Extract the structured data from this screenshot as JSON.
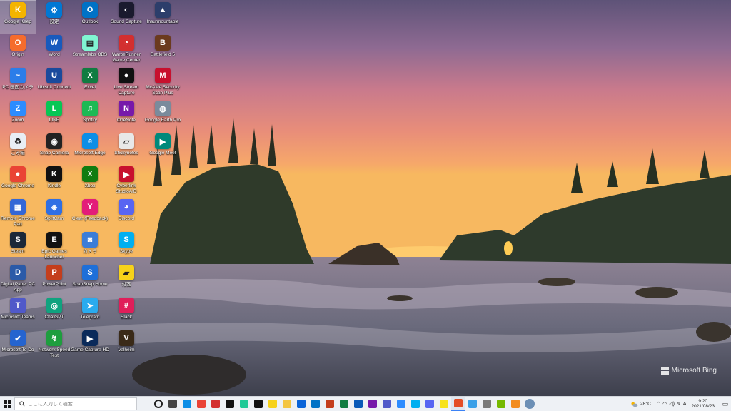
{
  "desktop_icons": [
    {
      "label": "Google Keep",
      "color": "#f4b400",
      "glyph": "K",
      "selected": true
    },
    {
      "label": "Origin",
      "color": "#f56c2d",
      "glyph": "O"
    },
    {
      "label": "PC 画面カメラ",
      "color": "#2b7de9",
      "glyph": "~"
    },
    {
      "label": "Zoom",
      "color": "#2d8cff",
      "glyph": "Z"
    },
    {
      "label": "ごみ箱",
      "color": "#e8eef5",
      "glyph": "♻"
    },
    {
      "label": "Google Chrome",
      "color": "#ea4335",
      "glyph": "●"
    },
    {
      "label": "Remote Chrome Pad",
      "color": "#3367d6",
      "glyph": "▦"
    },
    {
      "label": "Steam",
      "color": "#1b2838",
      "glyph": "S"
    },
    {
      "label": "Digital Paper PC App",
      "color": "#2b5aa8",
      "glyph": "D"
    },
    {
      "label": "Microsoft Teams",
      "color": "#5059c9",
      "glyph": "T"
    },
    {
      "label": "Microsoft To Do",
      "color": "#2564cf",
      "glyph": "✔"
    },
    {
      "label": "設定",
      "color": "#0078d4",
      "glyph": "⚙"
    },
    {
      "label": "Word",
      "color": "#185abd",
      "glyph": "W"
    },
    {
      "label": "Ubisoft Connect",
      "color": "#1a4a9c",
      "glyph": "U"
    },
    {
      "label": "LINE",
      "color": "#06c755",
      "glyph": "L"
    },
    {
      "label": "Snap Camera",
      "color": "#222222",
      "glyph": "◉"
    },
    {
      "label": "Kindle",
      "color": "#111111",
      "glyph": "K"
    },
    {
      "label": "SplitCam",
      "color": "#2f6fe4",
      "glyph": "◈"
    },
    {
      "label": "Epic Games Launcher",
      "color": "#121212",
      "glyph": "E"
    },
    {
      "label": "PowerPoint",
      "color": "#c43e1c",
      "glyph": "P"
    },
    {
      "label": "ChatGPT",
      "color": "#10a37f",
      "glyph": "◎"
    },
    {
      "label": "Network Speed Test",
      "color": "#1e9e3e",
      "glyph": "↯"
    },
    {
      "label": "Outlook",
      "color": "#0072c6",
      "glyph": "O"
    },
    {
      "label": "Streamlabs OBS",
      "color": "#80f5d2",
      "glyph": "▤"
    },
    {
      "label": "Excel",
      "color": "#107c41",
      "glyph": "X"
    },
    {
      "label": "Spotify",
      "color": "#1db954",
      "glyph": "♫"
    },
    {
      "label": "Microsoft Edge",
      "color": "#0c8ee6",
      "glyph": "e"
    },
    {
      "label": "Xbox",
      "color": "#107c10",
      "glyph": "X"
    },
    {
      "label": "Clear (Feedback)",
      "color": "#e31c79",
      "glyph": "Y"
    },
    {
      "label": "カメラ",
      "color": "#3b7dd8",
      "glyph": "◙"
    },
    {
      "label": "ScanSnap Home",
      "color": "#1e6fd9",
      "glyph": "S"
    },
    {
      "label": "Telegram",
      "color": "#2aabee",
      "glyph": "➤"
    },
    {
      "label": "Game Capture HD",
      "color": "#0a2a5a",
      "glyph": "▶"
    },
    {
      "label": "Sound Capture",
      "color": "#1a1a2e",
      "glyph": "◐"
    },
    {
      "label": "WarpeRunner Game Center",
      "color": "#d32f2f",
      "glyph": "◔"
    },
    {
      "label": "Live Stream Capture",
      "color": "#111111",
      "glyph": "●"
    },
    {
      "label": "OneNote",
      "color": "#7719aa",
      "glyph": "N"
    },
    {
      "label": "Stickynotes",
      "color": "#e8e8e8",
      "glyph": "▱"
    },
    {
      "label": "Cyberlink StudioAID",
      "color": "#c8102e",
      "glyph": "▶"
    },
    {
      "label": "Discord",
      "color": "#5865f2",
      "glyph": "◕"
    },
    {
      "label": "Skype",
      "color": "#00aff0",
      "glyph": "S"
    },
    {
      "label": "付箋",
      "color": "#f7d21a",
      "glyph": "▰"
    },
    {
      "label": "Slack",
      "color": "#e01e5a",
      "glyph": "#"
    },
    {
      "label": "Valheim",
      "color": "#3a2a18",
      "glyph": "V"
    },
    {
      "label": "Insurmountable",
      "color": "#2c3e6b",
      "glyph": "▲"
    },
    {
      "label": "Battlefield 5",
      "color": "#6b3a1e",
      "glyph": "B"
    },
    {
      "label": "McAfee Security Scan Plus",
      "color": "#c8102e",
      "glyph": "M"
    },
    {
      "label": "Google Earth Pro",
      "color": "#7a8b9c",
      "glyph": "◍"
    },
    {
      "label": "Google Meet",
      "color": "#00897b",
      "glyph": "▶"
    }
  ],
  "wallpaper_watermark": "Microsoft Bing",
  "taskbar": {
    "search_placeholder": "ここに入力して検索",
    "pinned": [
      {
        "name": "cortana",
        "color": "#222222"
      },
      {
        "name": "task-view",
        "color": "#444444"
      },
      {
        "name": "edge",
        "color": "#0c8ee6"
      },
      {
        "name": "chrome",
        "color": "#ea4335"
      },
      {
        "name": "media-player",
        "color": "#d32f2f"
      },
      {
        "name": "live-capture",
        "color": "#111111"
      },
      {
        "name": "stream",
        "color": "#20c997"
      },
      {
        "name": "kindle",
        "color": "#111111"
      },
      {
        "name": "sticky",
        "color": "#f7d21a"
      },
      {
        "name": "explorer",
        "color": "#f4c542"
      },
      {
        "name": "onedrive",
        "color": "#0a64d8"
      },
      {
        "name": "outlook",
        "color": "#0072c6"
      },
      {
        "name": "powerpoint",
        "color": "#c43e1c"
      },
      {
        "name": "excel",
        "color": "#107c41"
      },
      {
        "name": "outlook-2",
        "color": "#0a5ab8"
      },
      {
        "name": "onenote",
        "color": "#7719aa"
      },
      {
        "name": "teams",
        "color": "#5059c9"
      },
      {
        "name": "zoom",
        "color": "#2d8cff"
      },
      {
        "name": "skype",
        "color": "#00aff0"
      },
      {
        "name": "discord",
        "color": "#5865f2"
      },
      {
        "name": "sticky-2",
        "color": "#f7e21a"
      },
      {
        "name": "paint",
        "color": "#e44d26",
        "active": true
      },
      {
        "name": "browser",
        "color": "#3aa0e8"
      },
      {
        "name": "settings",
        "color": "#7a7a7a"
      },
      {
        "name": "nvidia",
        "color": "#76b900"
      },
      {
        "name": "store",
        "color": "#f28c1f"
      },
      {
        "name": "avatar",
        "color": "#6c8fb5"
      }
    ],
    "weather": "28°C",
    "ime": "A",
    "time": "9:20",
    "date": "2021/08/23"
  }
}
